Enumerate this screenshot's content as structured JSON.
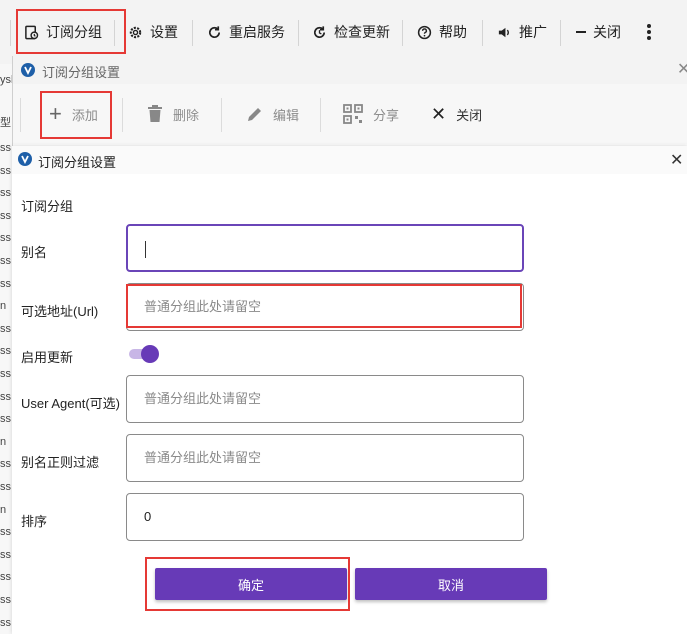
{
  "top_toolbar": {
    "items": [
      {
        "label": "订阅分组",
        "icon": "subscription-group-icon"
      },
      {
        "label": "设置",
        "icon": "gear-icon"
      },
      {
        "label": "重启服务",
        "icon": "restart-icon"
      },
      {
        "label": "检查更新",
        "icon": "update-icon"
      },
      {
        "label": "帮助",
        "icon": "help-icon"
      },
      {
        "label": "推广",
        "icon": "speaker-icon"
      },
      {
        "label": "关闭",
        "icon": "minus-icon"
      }
    ],
    "more_icon": "more-vertical-icon"
  },
  "left_strip": {
    "labels": [
      "ysh",
      "型",
      "ss",
      "ss",
      "ss",
      "ss",
      "ss",
      "ss",
      "ss",
      "n",
      "ss",
      "ss",
      "ss",
      "ss",
      "ss",
      "n",
      "ss",
      "ss",
      "n",
      "ss",
      "ss",
      "ss",
      "ss",
      "ss"
    ]
  },
  "window2": {
    "title": "订阅分组设置",
    "toolbar": {
      "add": "添加",
      "delete": "删除",
      "edit": "编辑",
      "share": "分享",
      "close": "关闭"
    }
  },
  "dialog": {
    "title": "订阅分组设置",
    "section_heading": "订阅分组",
    "fields": {
      "alias": {
        "label": "别名",
        "value": ""
      },
      "url": {
        "label": "可选地址(Url)",
        "placeholder": "普通分组此处请留空"
      },
      "enable_update": {
        "label": "启用更新",
        "on": true
      },
      "user_agent": {
        "label": "User Agent(可选)",
        "placeholder": "普通分组此处请留空"
      },
      "alias_filter": {
        "label": "别名正则过滤",
        "placeholder": "普通分组此处请留空"
      },
      "sort": {
        "label": "排序",
        "value": "0"
      }
    },
    "confirm": "确定",
    "cancel": "取消"
  },
  "colors": {
    "accent": "#673ab7",
    "highlight": "#e53935",
    "focus_border": "#6a45b8"
  }
}
